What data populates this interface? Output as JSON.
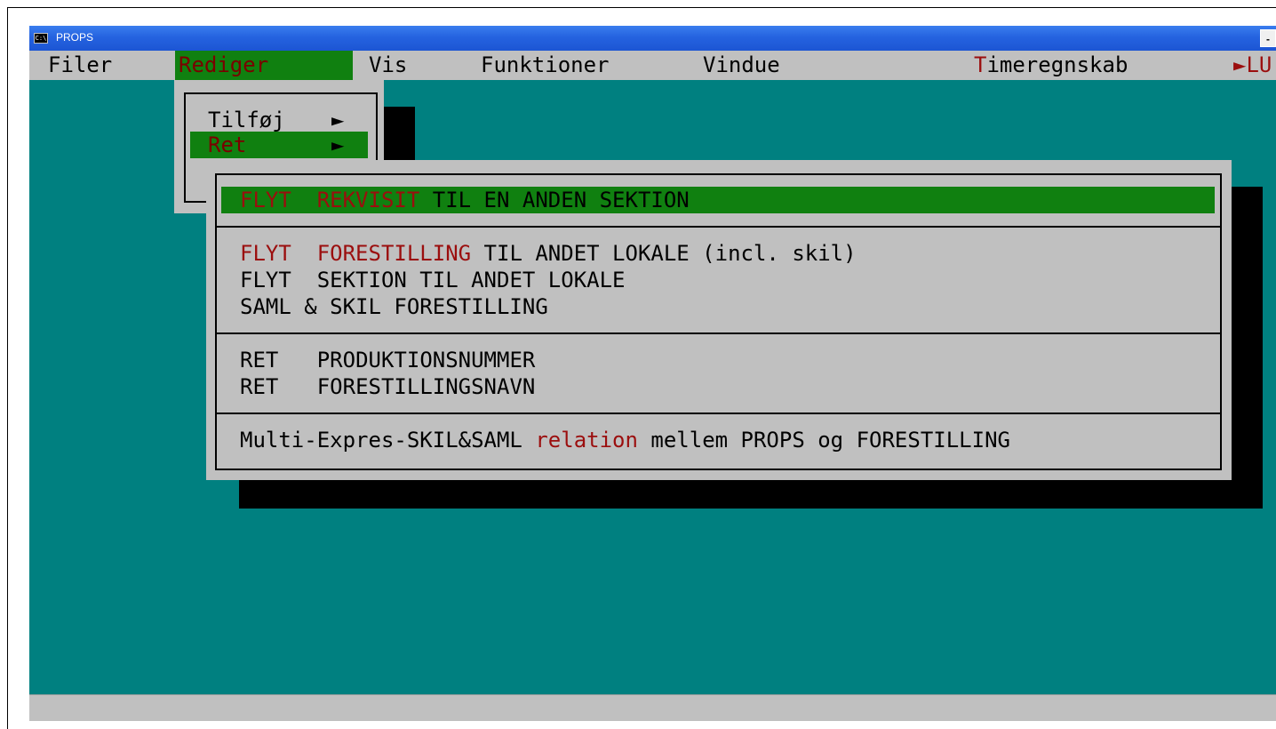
{
  "window": {
    "title": "PROPS",
    "icon_text": "C:\\",
    "minimize_glyph": "-"
  },
  "menubar": {
    "items": [
      "Filer",
      "Rediger",
      "Vis",
      "Funktioner",
      "Vindue"
    ],
    "timeregnskab": {
      "first": "T",
      "rest": "imeregnskab"
    },
    "overflow": {
      "arrow": "►",
      "text": "LU"
    }
  },
  "rediger_menu": {
    "items": [
      {
        "label": "Tilføj",
        "arrow": "►"
      },
      {
        "label": "Ret",
        "arrow": "►"
      }
    ]
  },
  "ret_submenu": {
    "item1": {
      "word1": "FLYT",
      "word2": "REKVISIT",
      "rest": "TIL EN ANDEN SEKTION"
    },
    "item2": {
      "word1": "FLYT",
      "word2": "FORESTILLING",
      "rest": "TIL ANDET LOKALE (incl. skil)"
    },
    "item3": {
      "word1": "FLYT",
      "rest": "SEKTION TIL ANDET LOKALE"
    },
    "item4": {
      "text": "SAML & SKIL FORESTILLING"
    },
    "item5": {
      "word1": "RET",
      "rest": "PRODUKTIONSNUMMER"
    },
    "item6": {
      "word1": "RET",
      "rest": "FORESTILLINGSNAVN"
    },
    "item7": {
      "before": "Multi-Expres-SKIL&SAML",
      "highlight": "relation",
      "after": "mellem PROPS og FORESTILLING"
    }
  },
  "colors": {
    "desktop": "#008080",
    "menu_gray": "#c0c0c0",
    "highlight_green": "#108010",
    "hotkey_red": "#9b0e0e",
    "titlebar_blue": "#2563e0"
  }
}
